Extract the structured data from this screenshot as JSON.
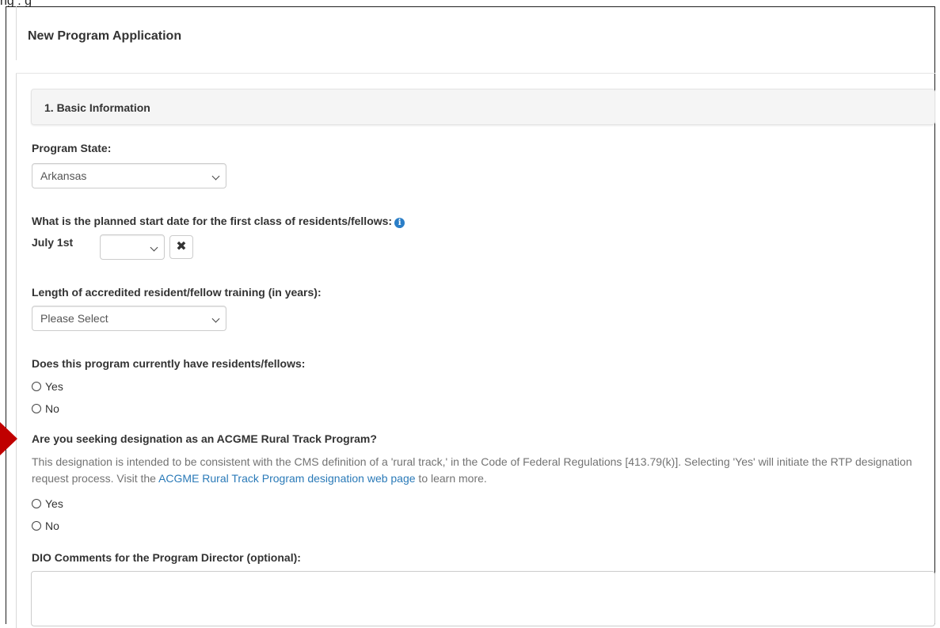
{
  "top_cut_text": "ng   .                                          g",
  "modal": {
    "title": "New Program Application"
  },
  "section": {
    "title": "1. Basic Information"
  },
  "program_state": {
    "label": "Program State:",
    "selected": "Arkansas"
  },
  "start_date": {
    "label": "What is the planned start date for the first class of residents/fellows:",
    "info_icon": "info-icon",
    "prefix": "July 1st",
    "selected": "",
    "clear_icon": "close-icon",
    "clear_glyph": "✖"
  },
  "training_length": {
    "label": "Length of accredited resident/fellow training (in years):",
    "selected": "Please Select"
  },
  "current_residents": {
    "label": "Does this program currently have residents/fellows:",
    "options": [
      "Yes",
      "No"
    ]
  },
  "rural_track": {
    "label": "Are you seeking designation as an ACGME Rural Track Program?",
    "help_before_link": "This designation is intended to be consistent with the CMS definition of a 'rural track,' in the Code of Federal Regulations [413.79(k)]. Selecting 'Yes' will initiate the RTP designation request process. Visit the ",
    "help_link": "ACGME Rural Track Program designation web page",
    "help_after_link": " to learn more.",
    "options": [
      "Yes",
      "No"
    ]
  },
  "dio_comments": {
    "label": "DIO Comments for the Program Director (optional):",
    "value": ""
  },
  "colors": {
    "link": "#2a7ab8",
    "info_icon": "#2a7ec7",
    "annotation_arrow": "#c00000"
  }
}
